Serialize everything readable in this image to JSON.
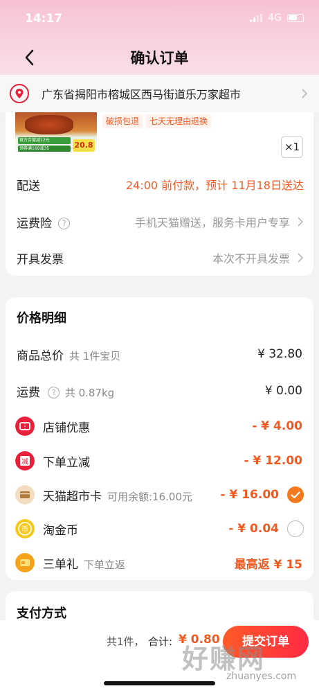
{
  "status_bar": {
    "time": "14:17",
    "network": "4G"
  },
  "nav": {
    "title": "确认订单"
  },
  "address": {
    "text": "广东省揭阳市榕城区西马街道乐万家超市"
  },
  "product": {
    "image_tag1": "官方合营减12元",
    "image_tag2": "领券满169减35",
    "image_price": "20.8",
    "service_tags": [
      "破损包退",
      "七天无理由退换"
    ],
    "quantity": "×1"
  },
  "delivery": {
    "label": "配送",
    "value": "24:00 前付款，预计 11月18日送达"
  },
  "shipping_insurance": {
    "label": "运费险",
    "help_icon": "?",
    "value": "手机天猫赠送，服务卡用户专享"
  },
  "invoice": {
    "label": "开具发票",
    "value": "本次不开具发票"
  },
  "price_detail": {
    "title": "价格明细",
    "goods_total": {
      "label": "商品总价",
      "sub": "共 1件宝贝",
      "amount": "¥ 32.80"
    },
    "freight": {
      "label": "运费",
      "sub": "共 0.87kg",
      "amount": "¥ 0.00"
    },
    "discounts": [
      {
        "label": "店铺优惠",
        "sub": "",
        "amount": "- ¥ 4.00",
        "icon": "ticket-icon",
        "color": "#e8203a"
      },
      {
        "label": "下单立减",
        "sub": "",
        "amount": "- ¥ 12.00",
        "icon": "reduce-icon",
        "color": "#e8203a"
      },
      {
        "label": "天猫超市卡",
        "sub": "可用余额:16.00元",
        "amount": "- ¥ 16.00",
        "icon": "card-icon",
        "color": "#f3dcc0",
        "checked": true
      },
      {
        "label": "淘金币",
        "sub": "",
        "amount": "- ¥ 0.04",
        "icon": "coin-icon",
        "color": "#f6c91f",
        "checked": false
      },
      {
        "label": "三单礼",
        "sub": "下单立返",
        "amount": "最高返 ¥ 15",
        "icon": "gift-card-icon",
        "color": "#f7a21b"
      }
    ]
  },
  "payment": {
    "title": "支付方式"
  },
  "bottom": {
    "count": "共1件，",
    "total_label": "合计:",
    "total": "¥ 0.80",
    "submit": "提交订单"
  },
  "watermark": {
    "big": "好赚网",
    "small": "zhuanyes.com"
  },
  "colors": {
    "accent": "#f05a22",
    "brand_red": "#ff2a43"
  }
}
